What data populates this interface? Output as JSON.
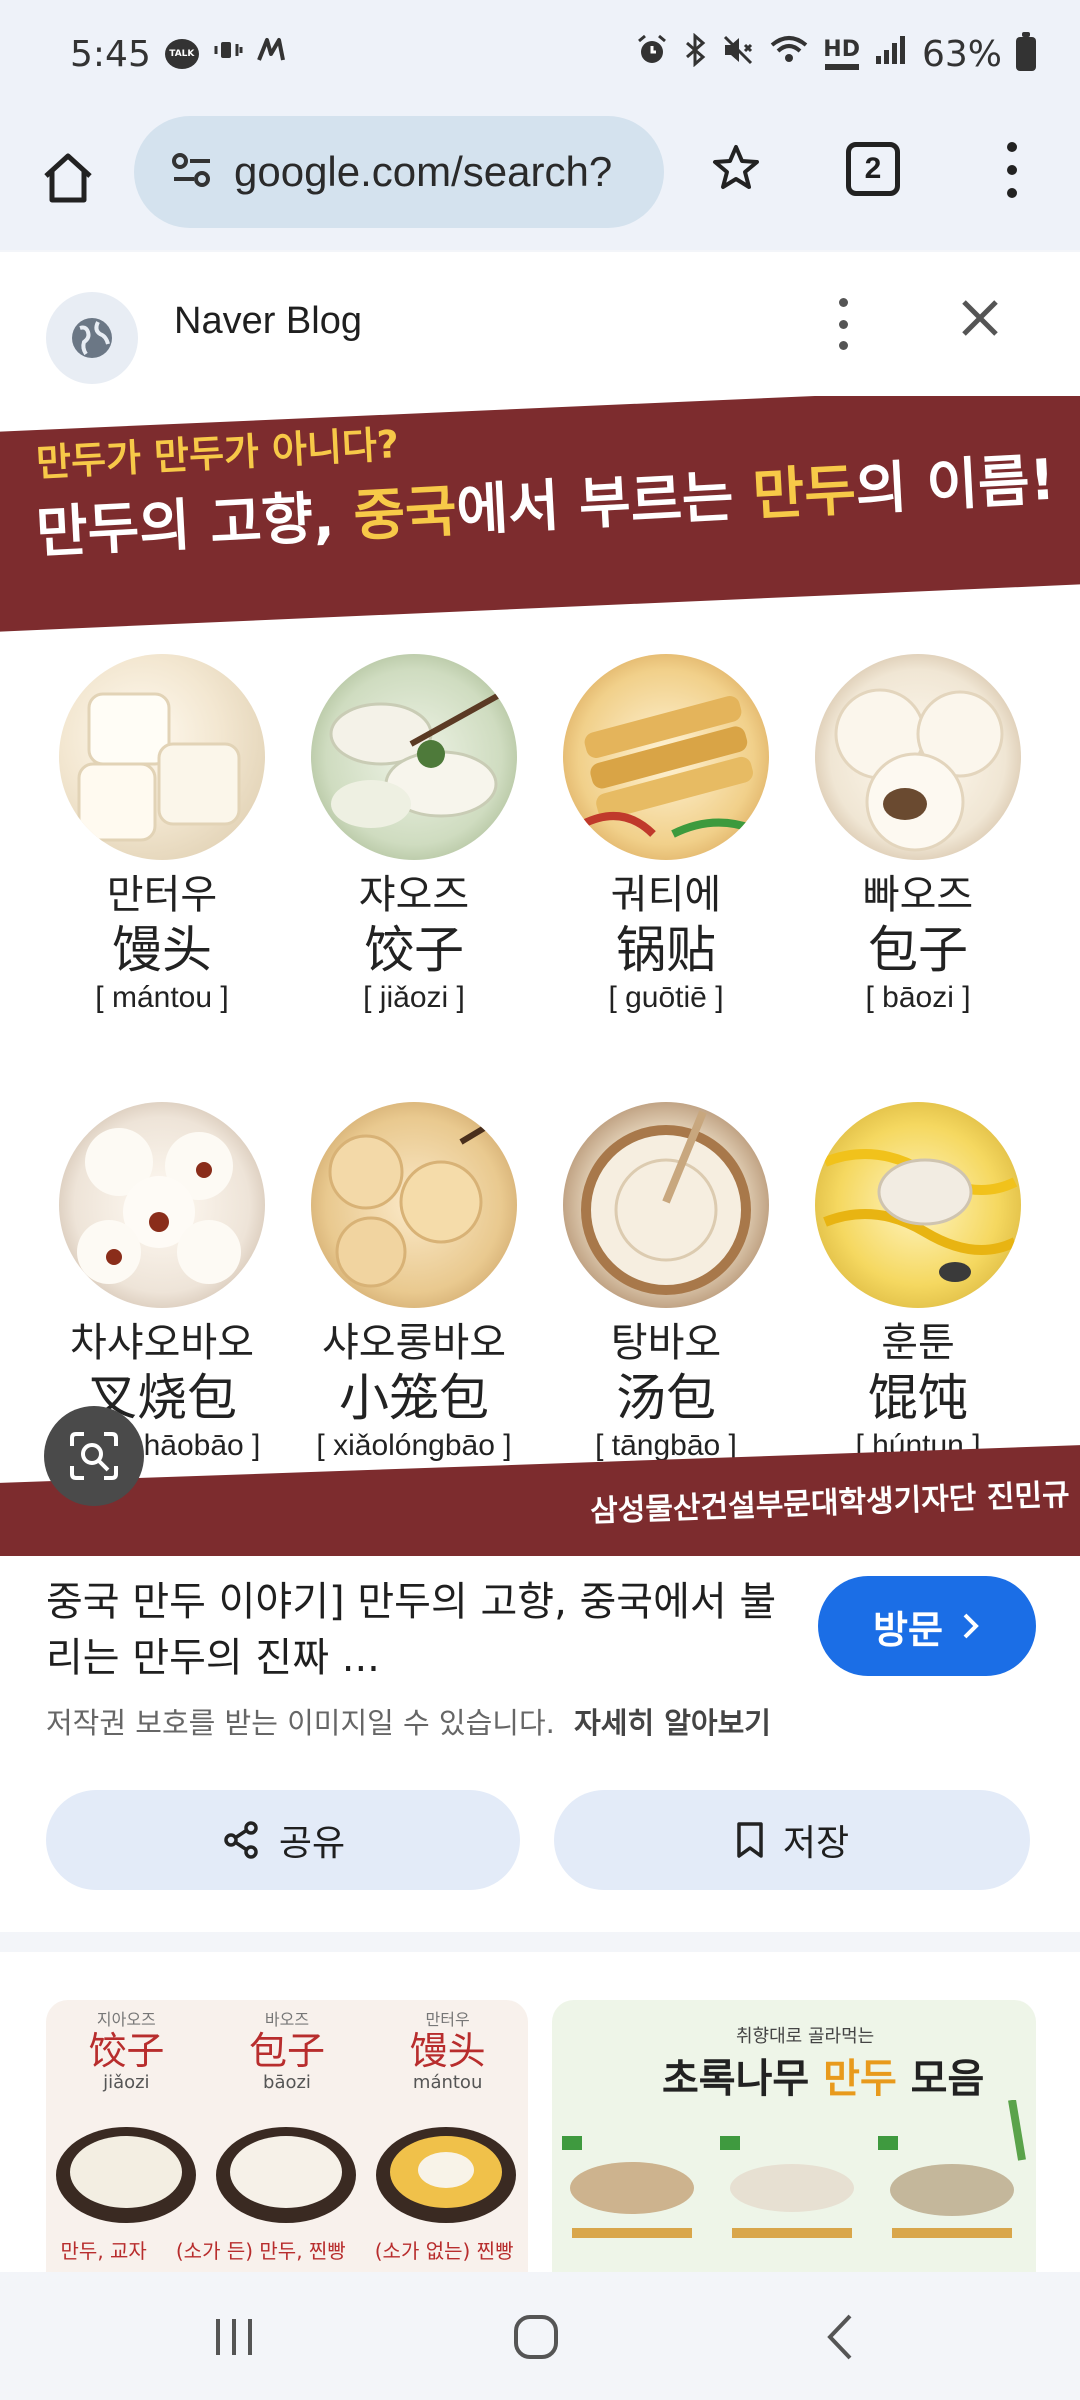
{
  "status_bar": {
    "time": "5:45",
    "talk_badge": "TALK",
    "battery": "63%",
    "hd_label": "HD",
    "icons": [
      "talk-icon",
      "mute-vibrate-icon",
      "m-icon",
      "alarm-icon",
      "bluetooth-icon",
      "volume-mute-icon",
      "wifi-icon",
      "hd-voice-icon",
      "signal-icon",
      "battery-icon"
    ]
  },
  "browser": {
    "url": "google.com/search?",
    "tab_count": "2"
  },
  "panel": {
    "site_name": "Naver Blog",
    "image": {
      "banner_small": "만두가 만두가 아니다?",
      "banner_part1": "만두의 고향, ",
      "banner_hl1": "중국",
      "banner_part2": "에서 부르는 ",
      "banner_hl2": "만두",
      "banner_part3": "의 이름!",
      "items": [
        {
          "ko": "만터우",
          "cn": "馒头",
          "pinyin": "[ mántou ]"
        },
        {
          "ko": "쟈오즈",
          "cn": "饺子",
          "pinyin": "[ jiǎozi ]"
        },
        {
          "ko": "궈티에",
          "cn": "锅贴",
          "pinyin": "[ guōtiē ]"
        },
        {
          "ko": "빠오즈",
          "cn": "包子",
          "pinyin": "[ bāozi ]"
        },
        {
          "ko": "차샤오바오",
          "cn": "叉烧包",
          "pinyin": "[ chāshāobāo ]"
        },
        {
          "ko": "샤오롱바오",
          "cn": "小笼包",
          "pinyin": "[ xiǎolóngbāo ]"
        },
        {
          "ko": "탕바오",
          "cn": "汤包",
          "pinyin": "[ tāngbāo ]"
        },
        {
          "ko": "훈툰",
          "cn": "馄饨",
          "pinyin": "[ húntun ]"
        }
      ],
      "footer": "삼성물산건설부문대학생기자단 진민규"
    },
    "result_title": "중국 만두 이야기] 만두의 고향, 중국에서 불리는 만두의 진짜 ...",
    "visit_label": "방문",
    "copyright": "저작권 보호를 받는 이미지일 수 있습니다.",
    "learn_more": "자세히 알아보기",
    "share_label": "공유",
    "save_label": "저장"
  },
  "related": {
    "thumb1": {
      "labels": [
        {
          "small": "지아오즈",
          "cn": "饺子",
          "pinyin": "jiǎozi"
        },
        {
          "small": "바오즈",
          "cn": "包子",
          "pinyin": "bāozi"
        },
        {
          "small": "만터우",
          "cn": "馒头",
          "pinyin": "mántou"
        }
      ],
      "captions": [
        "만두, 교자",
        "(소가 든) 만두, 찐빵",
        "(소가 없는) 찐빵"
      ]
    },
    "thumb2": {
      "sub": "취향대로 골라먹는",
      "title_part1": "초록나무 ",
      "title_hl": "만두",
      "title_part2": " 모음"
    }
  },
  "colors": {
    "banner": "#7d2c2e",
    "highlight": "#f7c948",
    "visit_button": "#1b6ee6",
    "pill_button": "#e3ebf8",
    "url_pill": "#d4e2ee"
  }
}
